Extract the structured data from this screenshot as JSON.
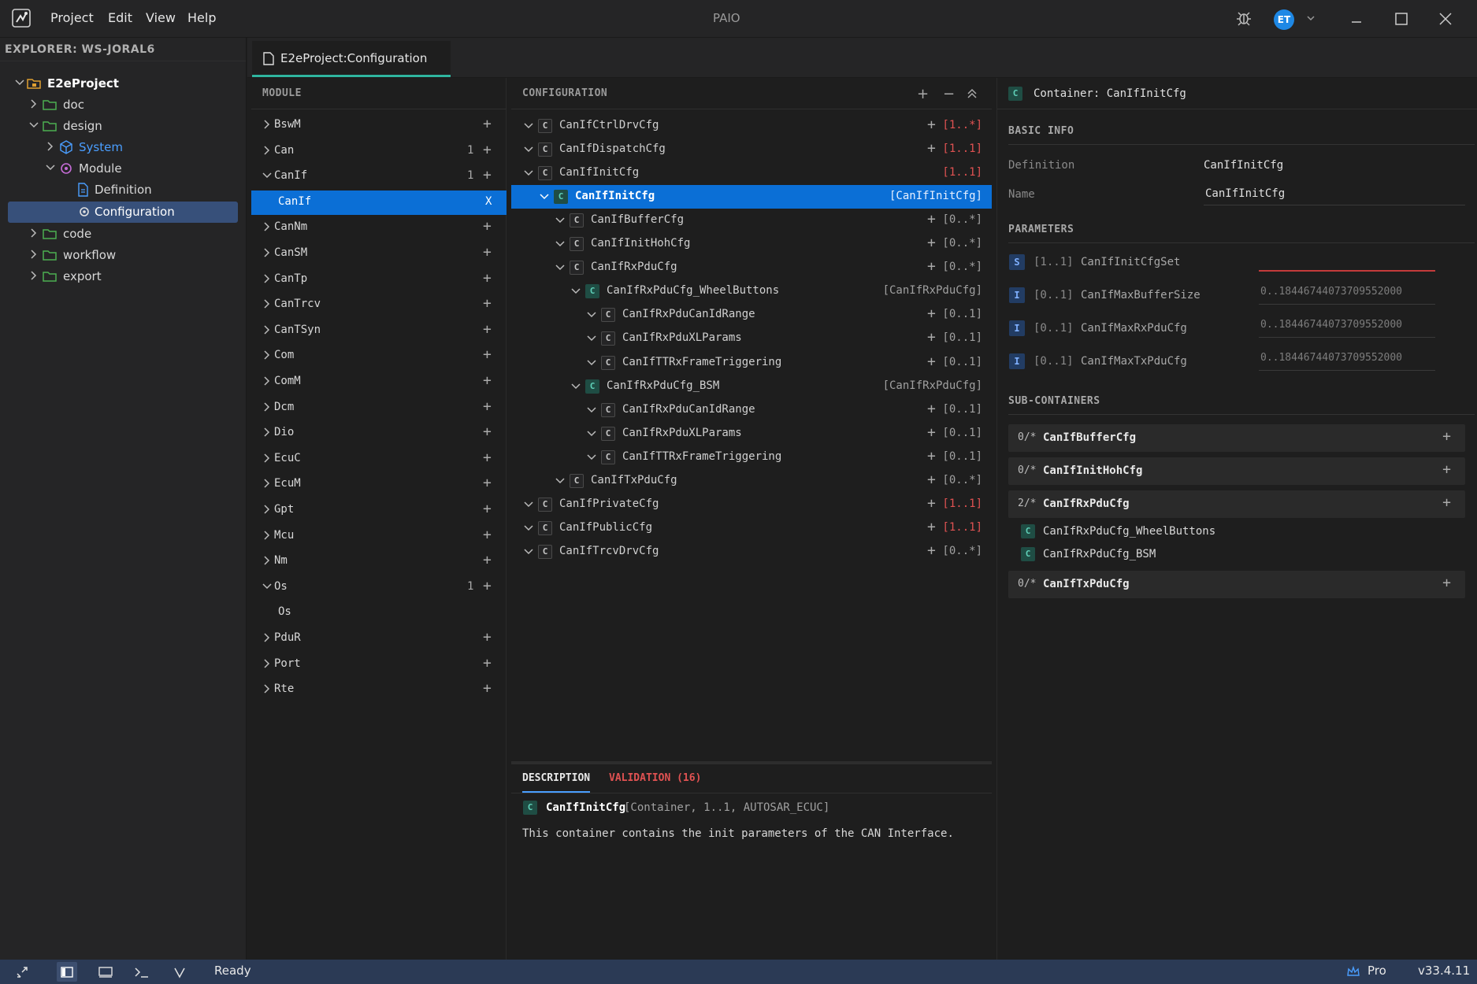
{
  "app": {
    "title": "PAIO",
    "menu": [
      "Project",
      "Edit",
      "View",
      "Help"
    ],
    "user_initials": "ET",
    "accent": "#2fb59f",
    "selection": "#0b6fd6"
  },
  "explorer": {
    "header": "EXPLORER: WS-JORAL6",
    "items": [
      {
        "label": "E2eProject",
        "icon": "project-folder-icon"
      },
      {
        "label": "doc",
        "icon": "folder-icon"
      },
      {
        "label": "design",
        "icon": "folder-icon"
      },
      {
        "label": "System",
        "icon": "cube-icon"
      },
      {
        "label": "Module",
        "icon": "module-icon"
      },
      {
        "label": "Definition",
        "icon": "document-icon"
      },
      {
        "label": "Configuration",
        "icon": "config-gear-icon"
      },
      {
        "label": "code",
        "icon": "folder-icon"
      },
      {
        "label": "workflow",
        "icon": "folder-icon"
      },
      {
        "label": "export",
        "icon": "folder-icon"
      }
    ]
  },
  "editor_tab": {
    "label": "E2eProject:Configuration"
  },
  "module_panel": {
    "header": "MODULE",
    "items": [
      {
        "label": "BswM",
        "count": ""
      },
      {
        "label": "Can",
        "count": "1"
      },
      {
        "label": "CanIf",
        "count": "1"
      },
      {
        "label": "CanIf",
        "count": "",
        "close": "X"
      },
      {
        "label": "CanNm",
        "count": ""
      },
      {
        "label": "CanSM",
        "count": ""
      },
      {
        "label": "CanTp",
        "count": ""
      },
      {
        "label": "CanTrcv",
        "count": ""
      },
      {
        "label": "CanTSyn",
        "count": ""
      },
      {
        "label": "Com",
        "count": ""
      },
      {
        "label": "ComM",
        "count": ""
      },
      {
        "label": "Dcm",
        "count": ""
      },
      {
        "label": "Dio",
        "count": ""
      },
      {
        "label": "EcuC",
        "count": ""
      },
      {
        "label": "EcuM",
        "count": ""
      },
      {
        "label": "Gpt",
        "count": ""
      },
      {
        "label": "Mcu",
        "count": ""
      },
      {
        "label": "Nm",
        "count": ""
      },
      {
        "label": "Os",
        "count": "1"
      },
      {
        "label": "Os",
        "count": ""
      },
      {
        "label": "PduR",
        "count": ""
      },
      {
        "label": "Port",
        "count": ""
      },
      {
        "label": "Rte",
        "count": ""
      }
    ]
  },
  "config_panel": {
    "header": "CONFIGURATION",
    "items": [
      {
        "label": "CanIfCtrlDrvCfg",
        "mult": "[1..*]"
      },
      {
        "label": "CanIfDispatchCfg",
        "mult": "[1..1]"
      },
      {
        "label": "CanIfInitCfg",
        "mult": "[1..1]"
      },
      {
        "label": "CanIfInitCfg",
        "mult": "[CanIfInitCfg]"
      },
      {
        "label": "CanIfBufferCfg",
        "mult": "[0..*]"
      },
      {
        "label": "CanIfInitHohCfg",
        "mult": "[0..*]"
      },
      {
        "label": "CanIfRxPduCfg",
        "mult": "[0..*]"
      },
      {
        "label": "CanIfRxPduCfg_WheelButtons",
        "mult": "[CanIfRxPduCfg]"
      },
      {
        "label": "CanIfRxPduCanIdRange",
        "mult": "[0..1]"
      },
      {
        "label": "CanIfRxPduXLParams",
        "mult": "[0..1]"
      },
      {
        "label": "CanIfTTRxFrameTriggering",
        "mult": "[0..1]"
      },
      {
        "label": "CanIfRxPduCfg_BSM",
        "mult": "[CanIfRxPduCfg]"
      },
      {
        "label": "CanIfRxPduCanIdRange",
        "mult": "[0..1]"
      },
      {
        "label": "CanIfRxPduXLParams",
        "mult": "[0..1]"
      },
      {
        "label": "CanIfTTRxFrameTriggering",
        "mult": "[0..1]"
      },
      {
        "label": "CanIfTxPduCfg",
        "mult": "[0..*]"
      },
      {
        "label": "CanIfPrivateCfg",
        "mult": "[1..1]"
      },
      {
        "label": "CanIfPublicCfg",
        "mult": "[1..1]"
      },
      {
        "label": "CanIfTrcvDrvCfg",
        "mult": "[0..*]"
      }
    ]
  },
  "description_panel": {
    "tab_description": "DESCRIPTION",
    "tab_validation": "VALIDATION (16)",
    "badge": "C",
    "name": "CanIfInitCfg",
    "meta": "[Container, 1..1, AUTOSAR_ECUC]",
    "text": "This container contains the init parameters of the CAN Interface."
  },
  "detail_panel": {
    "title": "Container: CanIfInitCfg",
    "basic_info_header": "BASIC INFO",
    "definition_label": "Definition",
    "definition_value": "CanIfInitCfg",
    "name_label": "Name",
    "name_value": "CanIfInitCfg",
    "parameters_header": "PARAMETERS",
    "parameters": [
      {
        "badge": "S",
        "mult": "[1..1]",
        "name": "CanIfInitCfgSet",
        "placeholder": ""
      },
      {
        "badge": "I",
        "mult": "[0..1]",
        "name": "CanIfMaxBufferSize",
        "placeholder": "0..18446744073709552000"
      },
      {
        "badge": "I",
        "mult": "[0..1]",
        "name": "CanIfMaxRxPduCfg",
        "placeholder": "0..18446744073709552000"
      },
      {
        "badge": "I",
        "mult": "[0..1]",
        "name": "CanIfMaxTxPduCfg",
        "placeholder": "0..18446744073709552000"
      }
    ],
    "subcontainers_header": "SUB-CONTAINERS",
    "subcontainers": [
      {
        "count": "0/*",
        "name": "CanIfBufferCfg"
      },
      {
        "count": "0/*",
        "name": "CanIfInitHohCfg"
      },
      {
        "count": "2/*",
        "name": "CanIfRxPduCfg"
      },
      {
        "count": "0/*",
        "name": "CanIfTxPduCfg"
      }
    ],
    "rx_children": [
      "CanIfRxPduCfg_WheelButtons",
      "CanIfRxPduCfg_BSM"
    ]
  },
  "statusbar": {
    "status": "Ready",
    "plan": "Pro",
    "version": "v33.4.11"
  }
}
